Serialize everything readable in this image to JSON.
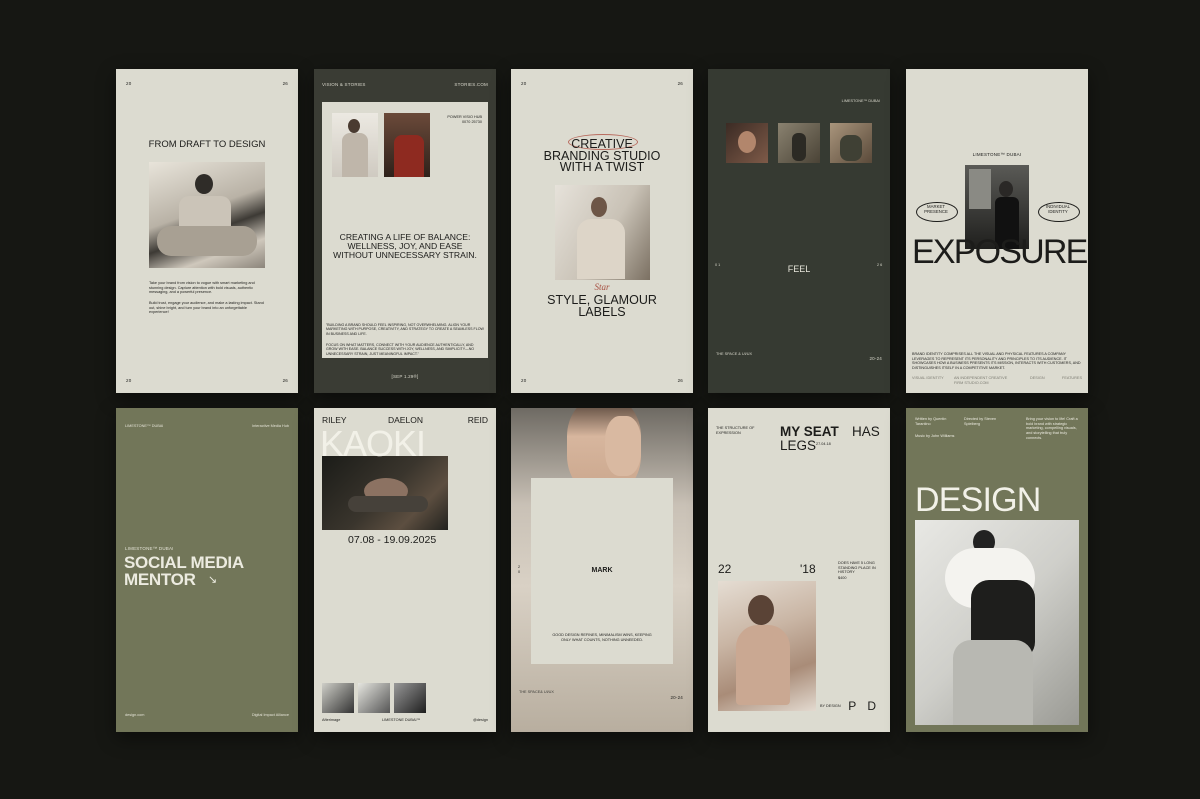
{
  "c1": {
    "page_left": "20",
    "page_right": "26",
    "title": "FROM DRAFT TO DESIGN",
    "body1": "Take your brand from vision to vogue with smart marketing and stunning design. Capture attention with bold visuals, authentic messaging, and a powerful presence.",
    "body2": "Build trust, engage your audience, and make a lasting impact. Stand out, shine bright, and turn your brand into an unforgettable experience!",
    "foot_left": "20",
    "foot_right": "26"
  },
  "c2": {
    "top_left": "VISION & STORIES",
    "top_right": "STORIES.COM",
    "side_note": "POWER VISIO HUB 0070 25730",
    "headline": "CREATING A LIFE OF BALANCE: WELLNESS, JOY, AND EASE WITHOUT UNNECESSARY STRAIN.",
    "quote1": "\"BUILDING A BRAND SHOULD FEEL INSPIRING, NOT OVERWHELMING. ALIGN YOUR MARKETING WITH PURPOSE, CREATIVITY, AND STRATEGY TO CREATE A SEAMLESS FLOW IN BUSINESS AND LIFE.",
    "quote2": "FOCUS ON WHAT MATTERS, CONNECT WITH YOUR AUDIENCE AUTHENTICALLY, AND GROW WITH EASE. BALANCE SUCCESS WITH JOY, WELLNESS, AND SIMPLICITY—NO UNNECESSARY STRAIN, JUST MEANINGFUL IMPACT.\"",
    "date": "[SEP 1.29®]"
  },
  "c3": {
    "page_left": "20",
    "page_right": "26",
    "headline": "CREATIVE BRANDING STUDIO WITH A TWIST",
    "script": "Star",
    "sub": "STYLE, GLAMOUR LABELS",
    "foot_left": "20",
    "foot_right": "26"
  },
  "c4": {
    "brand": "LIMESTONE™ DUBAI",
    "center": "FEEL",
    "side_left": "0 1",
    "side_right": "2 6",
    "foot_left": "THE SPACE & UI/UX",
    "foot_right": "20-24"
  },
  "c5": {
    "brand": "LIMESTONE™ DUBAI",
    "pill_left": "MARKET PRESENCE",
    "pill_right": "INDIVIDUAL IDENTITY",
    "headline": "EXPOSURE",
    "body": "BRAND IDENTITY COMPRISES ALL THE VISUAL AND PHYSICAL FEATURES A COMPANY LEVERAGES TO REPRESENT ITS PERSONALITY AND PRINCIPLES TO ITS AUDIENCE. IT SHOWCASES HOW A BUSINESS PRESENTS ITS MISSION, INTERACTS WITH CUSTOMERS, AND DISTINGUISHES ITSELF IN A COMPETITIVE MARKET.",
    "foot": [
      "VISUAL IDENTITY",
      "AN INDEPENDENT CREATIVE FIRM STUDIO.COM",
      "DESIGN",
      "FEATURES"
    ]
  },
  "c6": {
    "brand": "LIMESTONE™ DUBAI",
    "top_right": "Interactive Media Hub",
    "label": "LIMESTONE™ DUBAI",
    "headline1": "SOCIAL MEDIA",
    "headline2": "MENTOR",
    "arrow": "↘",
    "foot_left": "design.com",
    "foot_right": "Digital Impact Alliance"
  },
  "c7": {
    "names": [
      "RILEY",
      "DAELON",
      "REID"
    ],
    "headline": "KAOKI",
    "dates": "07.08 - 19.09.2025",
    "foot": [
      "Afterimage",
      "LIMESTONE DUBAI™",
      "@design"
    ]
  },
  "c8": {
    "label": "MARK",
    "side": "2 0",
    "body": "GOOD DESIGN REFINES, MINIMALISM WINS, KEEPING ONLY WHAT COUNTS, NOTHING UNNEEDED.",
    "foot_left": "THE SPACE& UI/UX",
    "foot_right": "20-24"
  },
  "c9": {
    "top_left": "THE STRUCTURE OF EXPRESSION",
    "headline1": "MY SEAT",
    "headline2": "HAS",
    "headline3": "LEGS",
    "small_date": "27.04.18",
    "num_left": "22",
    "num_right": "'18",
    "side_text": "DOES HAVE 5 LONG STANDING PLACE IN HISTORY",
    "side_code": "$400",
    "by": "BY DESIGN",
    "letters": "P D"
  },
  "c10": {
    "col1": "Written by Quentin Tarantino",
    "col2": "Directed by Steven Spielberg",
    "col3": "Bring your vision to life! Craft a bold brand with strategic marketing, compelling visuals, and storytelling that truly connects.",
    "music": "Music by John Williams",
    "headline": "DESIGN"
  }
}
